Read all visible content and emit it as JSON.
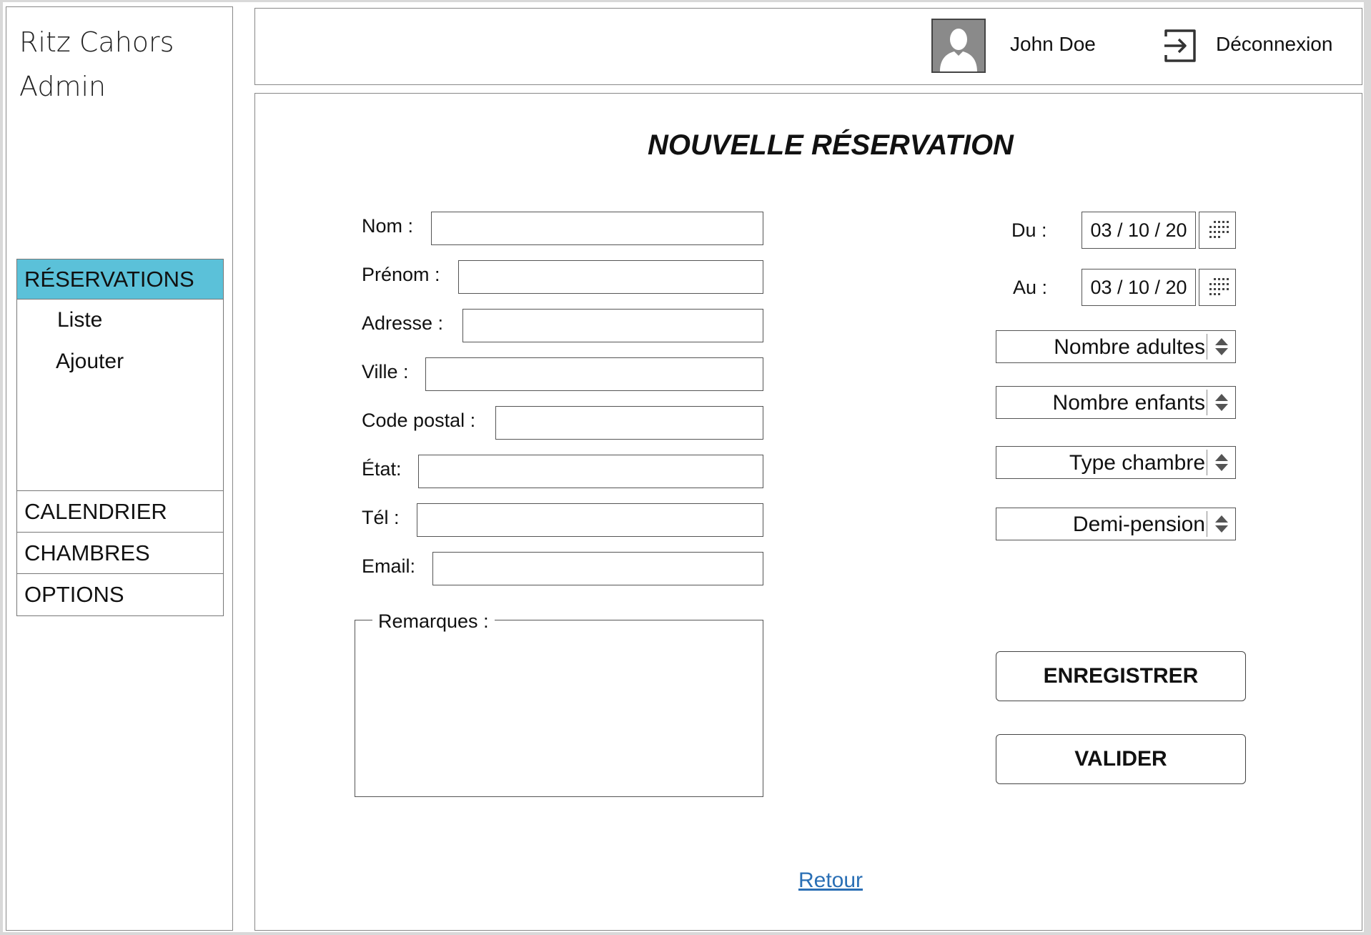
{
  "brand": {
    "line1": "Ritz Cahors",
    "line2": "Admin"
  },
  "sidebar": {
    "active_section": "RÉSERVATIONS",
    "sub_items": [
      "Liste",
      "Ajouter"
    ],
    "items": [
      "CALENDRIER",
      "CHAMBRES",
      "OPTIONS"
    ],
    "accent_color": "#5bc1d9"
  },
  "header": {
    "user_name": "John Doe",
    "logout_label": "Déconnexion",
    "avatar_icon": "user-avatar-icon",
    "logout_icon": "logout-icon"
  },
  "form": {
    "title": "NOUVELLE RÉSERVATION",
    "fields": {
      "nom": {
        "label": "Nom :",
        "value": ""
      },
      "prenom": {
        "label": "Prénom :",
        "value": ""
      },
      "adresse": {
        "label": "Adresse :",
        "value": ""
      },
      "ville": {
        "label": "Ville :",
        "value": ""
      },
      "code_postal": {
        "label": "Code postal :",
        "value": ""
      },
      "etat": {
        "label": "État:",
        "value": ""
      },
      "tel": {
        "label": "Tél :",
        "value": ""
      },
      "email": {
        "label": "Email:",
        "value": ""
      }
    },
    "remarks": {
      "label": "Remarques :",
      "value": ""
    },
    "date_from": {
      "label": "Du :",
      "value": "03 / 10 / 20"
    },
    "date_to": {
      "label": "Au :",
      "value": "03 / 10 / 20"
    },
    "selects": {
      "adults": "Nombre adultes",
      "children": "Nombre enfants",
      "room_type": "Type chambre",
      "half_board": "Demi-pension"
    },
    "buttons": {
      "save": "ENREGISTRER",
      "validate": "VALIDER"
    },
    "back_link": "Retour"
  }
}
